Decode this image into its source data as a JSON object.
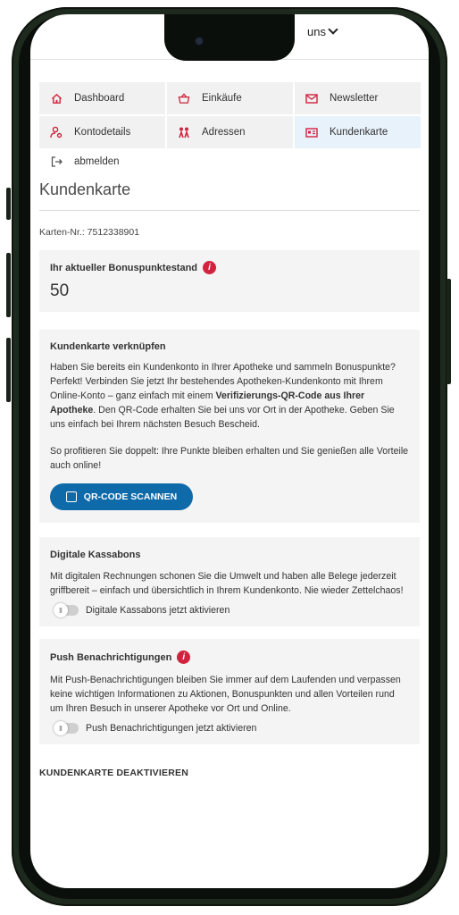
{
  "header": {
    "language_label": "uns"
  },
  "nav": {
    "items": [
      {
        "label": "Dashboard",
        "icon": "home-icon"
      },
      {
        "label": "Einkäufe",
        "icon": "basket-icon"
      },
      {
        "label": "Newsletter",
        "icon": "mail-icon"
      },
      {
        "label": "Kontodetails",
        "icon": "user-settings-icon"
      },
      {
        "label": "Adressen",
        "icon": "address-icon"
      },
      {
        "label": "Kundenkarte",
        "icon": "card-icon",
        "active": true
      }
    ],
    "logout_label": "abmelden"
  },
  "page": {
    "title": "Kundenkarte",
    "card_number": "Karten-Nr.: 7512338901"
  },
  "bonus": {
    "title": "Ihr aktueller Bonuspunktestand",
    "points": "50"
  },
  "link_card": {
    "title": "Kundenkarte verknüpfen",
    "para1_line1": "Haben Sie bereits ein Kundenkonto in Ihrer Apotheke und sammeln Bonuspunkte?",
    "para1_line2_start": "Perfekt! Verbinden Sie jetzt Ihr bestehendes Apotheken-Kundenkonto mit Ihrem Online-Konto – ganz einfach mit einem ",
    "para1_bold": "Verifizierungs-QR-Code aus Ihrer Apotheke",
    "para1_end": ". Den QR-Code erhalten Sie bei uns vor Ort in der Apotheke. Geben Sie uns einfach bei Ihrem nächsten Besuch Bescheid.",
    "para2": "So profitieren Sie doppelt: Ihre Punkte bleiben erhalten und Sie genießen alle Vorteile auch online!",
    "button_label": "QR-CODE SCANNEN"
  },
  "receipts": {
    "title": "Digitale Kassabons",
    "text": "Mit digitalen Rechnungen schonen Sie die Umwelt und haben alle Belege jederzeit griffbereit – einfach und übersichtlich in Ihrem Kundenkonto. Nie wieder Zettelchaos!",
    "toggle_label": "Digitale Kassabons jetzt aktivieren",
    "enabled": false
  },
  "push": {
    "title": "Push Benachrichtigungen",
    "text": "Mit Push-Benachrichtigungen bleiben Sie immer auf dem Laufenden und verpassen keine wichtigen Informationen zu Aktionen, Bonuspunkten und allen Vorteilen rund um Ihren Besuch in unserer Apotheke vor Ort und Online.",
    "toggle_label": "Push Benachrichtigungen jetzt aktivieren",
    "enabled": false
  },
  "deactivate_label": "KUNDENKARTE DEAKTIVIEREN",
  "colors": {
    "accent_red": "#d2233e",
    "primary_blue": "#0f6aa9",
    "active_nav_bg": "#e8f2fa",
    "panel_bg": "#f4f4f4"
  }
}
